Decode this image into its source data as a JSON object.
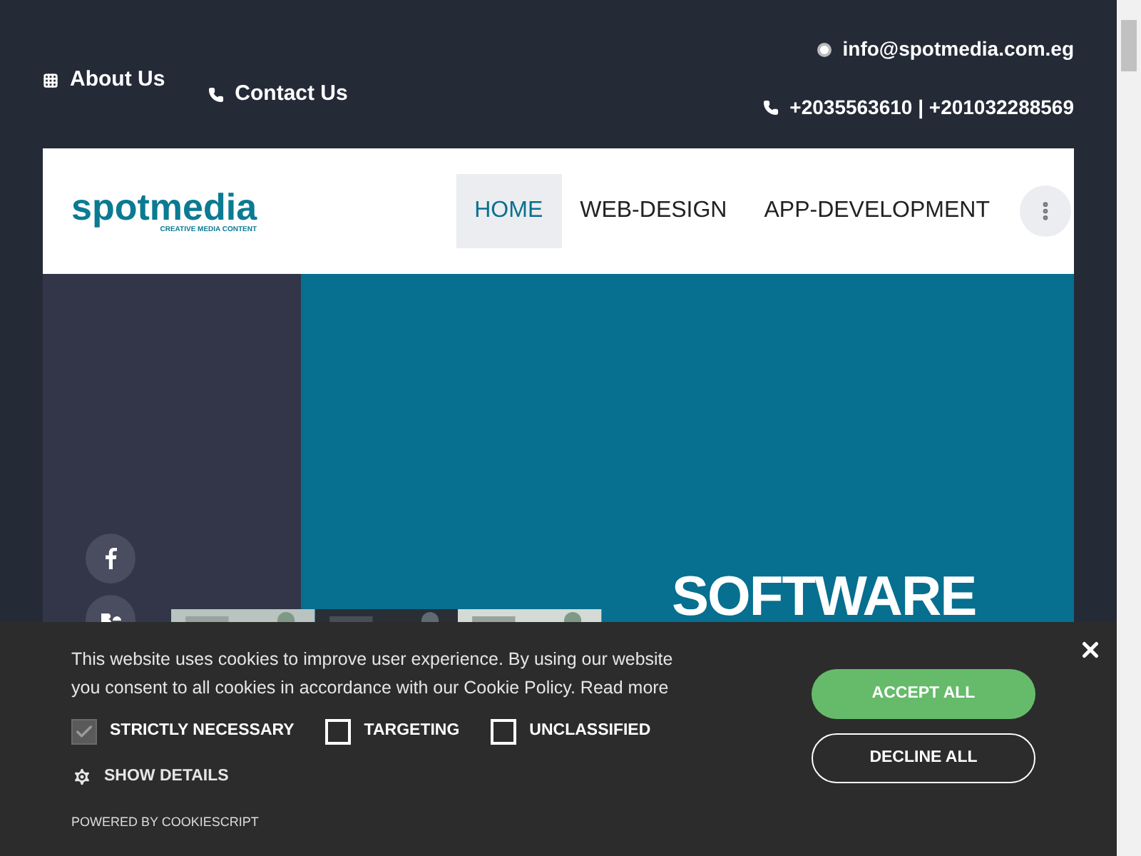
{
  "topbar": {
    "links": [
      {
        "kind": "grid",
        "label": "About Us"
      },
      {
        "kind": "phone",
        "label": "Contact Us"
      }
    ],
    "email": "info@spotmedia.com.eg",
    "phones": "+2035563610 | +201032288569"
  },
  "logo": {
    "name": "spotmedia",
    "tagline": "CREATIVE MEDIA CONTENT"
  },
  "nav": [
    {
      "label": "HOME",
      "selected": true
    },
    {
      "label": "WEB-DESIGN",
      "selected": false
    },
    {
      "label": "APP-DEVELOPMENT",
      "selected": false
    }
  ],
  "social": [
    {
      "kind": "facebook"
    },
    {
      "kind": "behance"
    }
  ],
  "hero": {
    "heading": "SOFTWARE"
  },
  "cookie_banner": {
    "text": "This website uses cookies to improve user experience. By using our website you consent to all cookies in accordance with our Cookie Policy.",
    "link": "Read more",
    "options": [
      {
        "label": "STRICTLY NECESSARY",
        "checked": true,
        "disabled": true
      },
      {
        "label": "TARGETING",
        "checked": false,
        "disabled": false
      },
      {
        "label": "UNCLASSIFIED",
        "checked": false,
        "disabled": false
      }
    ],
    "details": "SHOW DETAILS",
    "powered": "POWERED BY COOKIESCRIPT",
    "accept": "ACCEPT ALL",
    "decline": "DECLINE ALL"
  }
}
